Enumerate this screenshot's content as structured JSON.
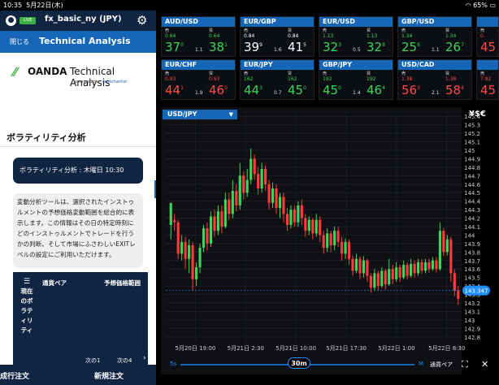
{
  "status_bar": {
    "time": "10:35",
    "date": "5月22日(木)",
    "battery": "65%"
  },
  "top_bar": {
    "live_badge": "LIVE",
    "account": "fx_basic_ny (JPY)",
    "settings_icon": "gear-icon",
    "user_icon": "person-icon"
  },
  "title_bar": {
    "close": "閉じる",
    "title": "Technical Analysis"
  },
  "logo": {
    "brand": "OANDA",
    "product": "Technical Analysis",
    "powered_by": "powered by",
    "partner": "autochartist"
  },
  "section_title": "ボラティリティ分析",
  "pill_text": "ボラティリティ分析 : 木曜日 10:30",
  "description": "変動分析ツールは、選択されたインストゥルメントの予想価格変動範囲を総合的に表示します。この情報はその日の特定時刻にどのインストゥルメントでトレードを行うかの判断、そして市場にふさわしいEXITレベルの設定にご利用いただけます。",
  "table": {
    "col1": "現在のボラティリティ",
    "col2": "通貨ペア",
    "col3": "予想価格範囲",
    "next1": "次の1",
    "next4": "次の4"
  },
  "bottom_bar": {
    "market_order": "成行注文",
    "new_order": "新規注文"
  },
  "rates": [
    {
      "pair": "AUD/USD",
      "sell": "売",
      "buy": "買",
      "sell_val": "0.64",
      "buy_val": "0.64",
      "sell_big": "37",
      "sell_sup": "0",
      "buy_big": "38",
      "buy_sup": "1",
      "spread": "1.1",
      "dir": "up"
    },
    {
      "pair": "EUR/GBP",
      "sell": "売",
      "buy": "買",
      "sell_val": "0.84",
      "buy_val": "0.84",
      "sell_big": "39",
      "sell_sup": "9",
      "buy_big": "41",
      "buy_sup": "5",
      "spread": "1.6",
      "dir": "flat"
    },
    {
      "pair": "EUR/USD",
      "sell": "売",
      "buy": "買",
      "sell_val": "1.13",
      "buy_val": "1.13",
      "sell_big": "32",
      "sell_sup": "3",
      "buy_big": "32",
      "buy_sup": "8",
      "spread": "0.5",
      "dir": "up"
    },
    {
      "pair": "GBP/USD",
      "sell": "売",
      "buy": "買",
      "sell_val": "1.34",
      "buy_val": "1.34",
      "sell_big": "25",
      "sell_sup": "6",
      "buy_big": "26",
      "buy_sup": "7",
      "spread": "1.1",
      "dir": "up"
    },
    {
      "pair": "EUR/CHF",
      "sell": "売",
      "buy": "買",
      "sell_val": "0.93",
      "buy_val": "0.93",
      "sell_big": "44",
      "sell_sup": "1",
      "buy_big": "46",
      "buy_sup": "0",
      "spread": "1.9",
      "dir": "down"
    },
    {
      "pair": "EUR/JPY",
      "sell": "売",
      "buy": "買",
      "sell_val": "162",
      "buy_val": "162",
      "sell_big": "44",
      "sell_sup": "3",
      "buy_big": "45",
      "buy_sup": "0",
      "spread": "0.7",
      "dir": "up"
    },
    {
      "pair": "GBP/JPY",
      "sell": "売",
      "buy": "買",
      "sell_val": "192",
      "buy_val": "192",
      "sell_big": "45",
      "sell_sup": "0",
      "buy_big": "46",
      "buy_sup": "4",
      "spread": "1.4",
      "dir": "up"
    },
    {
      "pair": "USD/CAD",
      "sell": "売",
      "buy": "買",
      "sell_val": "1.38",
      "buy_val": "1.38",
      "sell_big": "56",
      "sell_sup": "3",
      "buy_big": "58",
      "buy_sup": "4",
      "spread": "2.1",
      "dir": "down"
    }
  ],
  "rates_partial": [
    {
      "sell": "売",
      "sell_val": "0.",
      "sell_big": "45",
      "dir": "down"
    },
    {
      "sell": "売",
      "sell_val": "7.82",
      "sell_big": "45",
      "dir": "down"
    }
  ],
  "chart_header": {
    "symbol": "USD/JPY",
    "currency_glyph": "¥$€"
  },
  "chart_data": {
    "type": "candlestick",
    "symbol": "USD/JPY",
    "interval": "30m",
    "x_ticks": [
      "5月20日 19:00",
      "5月21日 2:30",
      "5月21日 10:00",
      "5月21日 17:30",
      "5月22日 1:00",
      "5月22日 8:30"
    ],
    "y_ticks": [
      "145.4",
      "145.3",
      "145.2",
      "145.1",
      "145",
      "144.9",
      "144.8",
      "144.7",
      "144.6",
      "144.5",
      "144.4",
      "144.3",
      "144.2",
      "144.1",
      "144",
      "143.9",
      "143.8",
      "143.7",
      "143.6",
      "143.5",
      "143.4",
      "143.3",
      "143.2",
      "143.1",
      "143",
      "142.9",
      "142.8"
    ],
    "last_price": "143.347",
    "ylim": [
      142.75,
      145.45
    ],
    "candles": [
      [
        144.12,
        144.38,
        144.18,
        143.95
      ],
      [
        144.18,
        144.15,
        144.25,
        144.05
      ],
      [
        144.15,
        143.78,
        144.18,
        143.72
      ],
      [
        143.78,
        143.92,
        144.0,
        143.7
      ],
      [
        143.92,
        143.72,
        143.98,
        143.6
      ],
      [
        143.72,
        143.88,
        143.95,
        143.55
      ],
      [
        143.88,
        143.48,
        143.92,
        143.35
      ],
      [
        143.48,
        143.62,
        143.68,
        143.4
      ],
      [
        143.62,
        143.85,
        143.9,
        143.55
      ],
      [
        143.85,
        144.08,
        144.12,
        143.8
      ],
      [
        144.08,
        143.9,
        144.15,
        143.82
      ],
      [
        143.9,
        144.22,
        144.28,
        143.86
      ],
      [
        144.22,
        144.05,
        144.3,
        143.98
      ],
      [
        144.05,
        144.28,
        144.35,
        144.0
      ],
      [
        144.28,
        144.1,
        144.35,
        144.02
      ],
      [
        144.1,
        144.42,
        144.5,
        144.08
      ],
      [
        144.42,
        144.25,
        144.5,
        144.18
      ],
      [
        144.25,
        144.52,
        144.65,
        144.2
      ],
      [
        144.52,
        144.35,
        144.6,
        144.28
      ],
      [
        144.35,
        144.7,
        144.85,
        144.3
      ],
      [
        144.7,
        144.5,
        144.75,
        144.42
      ],
      [
        144.5,
        144.65,
        144.78,
        144.45
      ],
      [
        144.65,
        144.9,
        145.02,
        144.6
      ],
      [
        144.9,
        144.72,
        144.95,
        144.65
      ],
      [
        144.72,
        144.55,
        144.8,
        144.48
      ],
      [
        144.55,
        144.78,
        144.85,
        144.5
      ],
      [
        144.78,
        144.6,
        144.82,
        144.52
      ],
      [
        144.6,
        144.38,
        144.65,
        144.3
      ],
      [
        144.38,
        144.55,
        144.62,
        144.32
      ],
      [
        144.55,
        144.32,
        144.6,
        144.25
      ],
      [
        144.32,
        144.45,
        144.5,
        144.2
      ],
      [
        144.45,
        144.25,
        144.5,
        144.15
      ],
      [
        144.25,
        144.12,
        144.32,
        144.05
      ],
      [
        144.12,
        144.3,
        144.35,
        144.08
      ],
      [
        144.3,
        144.15,
        144.35,
        144.1
      ],
      [
        144.15,
        144.35,
        144.4,
        144.1
      ],
      [
        144.35,
        144.2,
        144.42,
        144.12
      ],
      [
        144.2,
        144.05,
        144.25,
        143.98
      ],
      [
        144.05,
        144.18,
        144.22,
        144.0
      ],
      [
        144.18,
        144.02,
        144.2,
        143.95
      ],
      [
        144.02,
        144.18,
        144.25,
        143.98
      ],
      [
        144.18,
        144.0,
        144.22,
        143.92
      ],
      [
        144.0,
        143.85,
        144.05,
        143.78
      ],
      [
        143.85,
        144.02,
        144.08,
        143.8
      ],
      [
        144.02,
        143.88,
        144.05,
        143.8
      ],
      [
        143.88,
        144.05,
        144.1,
        143.82
      ],
      [
        144.05,
        143.92,
        144.1,
        143.86
      ],
      [
        143.92,
        143.78,
        143.98,
        143.7
      ],
      [
        143.78,
        143.92,
        143.96,
        143.72
      ],
      [
        143.92,
        143.72,
        143.95,
        143.65
      ],
      [
        143.72,
        143.58,
        143.76,
        143.52
      ],
      [
        143.58,
        143.72,
        143.78,
        143.55
      ],
      [
        143.72,
        143.55,
        143.75,
        143.48
      ],
      [
        143.55,
        143.7,
        143.75,
        143.5
      ],
      [
        143.7,
        143.52,
        143.72,
        143.45
      ],
      [
        143.52,
        143.38,
        143.55,
        143.32
      ],
      [
        143.38,
        143.55,
        143.6,
        143.35
      ],
      [
        143.55,
        143.4,
        143.58,
        143.35
      ],
      [
        143.4,
        143.58,
        143.62,
        143.38
      ],
      [
        143.58,
        143.42,
        143.6,
        143.36
      ],
      [
        143.42,
        143.6,
        143.72,
        143.4
      ],
      [
        143.6,
        143.48,
        143.65,
        143.42
      ],
      [
        143.48,
        143.62,
        143.68,
        143.45
      ],
      [
        143.62,
        143.5,
        143.65,
        143.45
      ],
      [
        143.5,
        143.65,
        143.7,
        143.48
      ],
      [
        143.65,
        143.52,
        143.68,
        143.48
      ],
      [
        143.52,
        143.66,
        143.72,
        143.5
      ],
      [
        143.66,
        143.55,
        143.7,
        143.5
      ],
      [
        143.55,
        143.68,
        143.72,
        143.52
      ],
      [
        143.68,
        143.58,
        143.72,
        143.54
      ],
      [
        143.58,
        143.68,
        143.72,
        143.55
      ],
      [
        143.68,
        143.6,
        143.72,
        143.56
      ],
      [
        143.6,
        143.7,
        143.74,
        143.58
      ],
      [
        143.7,
        143.6,
        143.74,
        143.56
      ],
      [
        143.6,
        144.05,
        144.15,
        143.58
      ],
      [
        144.05,
        143.8,
        144.08,
        143.75
      ],
      [
        143.8,
        143.95,
        144.0,
        143.76
      ],
      [
        143.95,
        143.55,
        143.98,
        143.45
      ],
      [
        143.55,
        143.35,
        143.6,
        143.28
      ],
      [
        143.35,
        143.25,
        143.4,
        143.18
      ]
    ]
  },
  "bottom_controls": {
    "s_label": "5s",
    "m_label": "M",
    "interval": "30m",
    "pair_label": "通貨ペア",
    "fullscreen_icon": "fullscreen-icon",
    "close_icon": "close-icon"
  }
}
